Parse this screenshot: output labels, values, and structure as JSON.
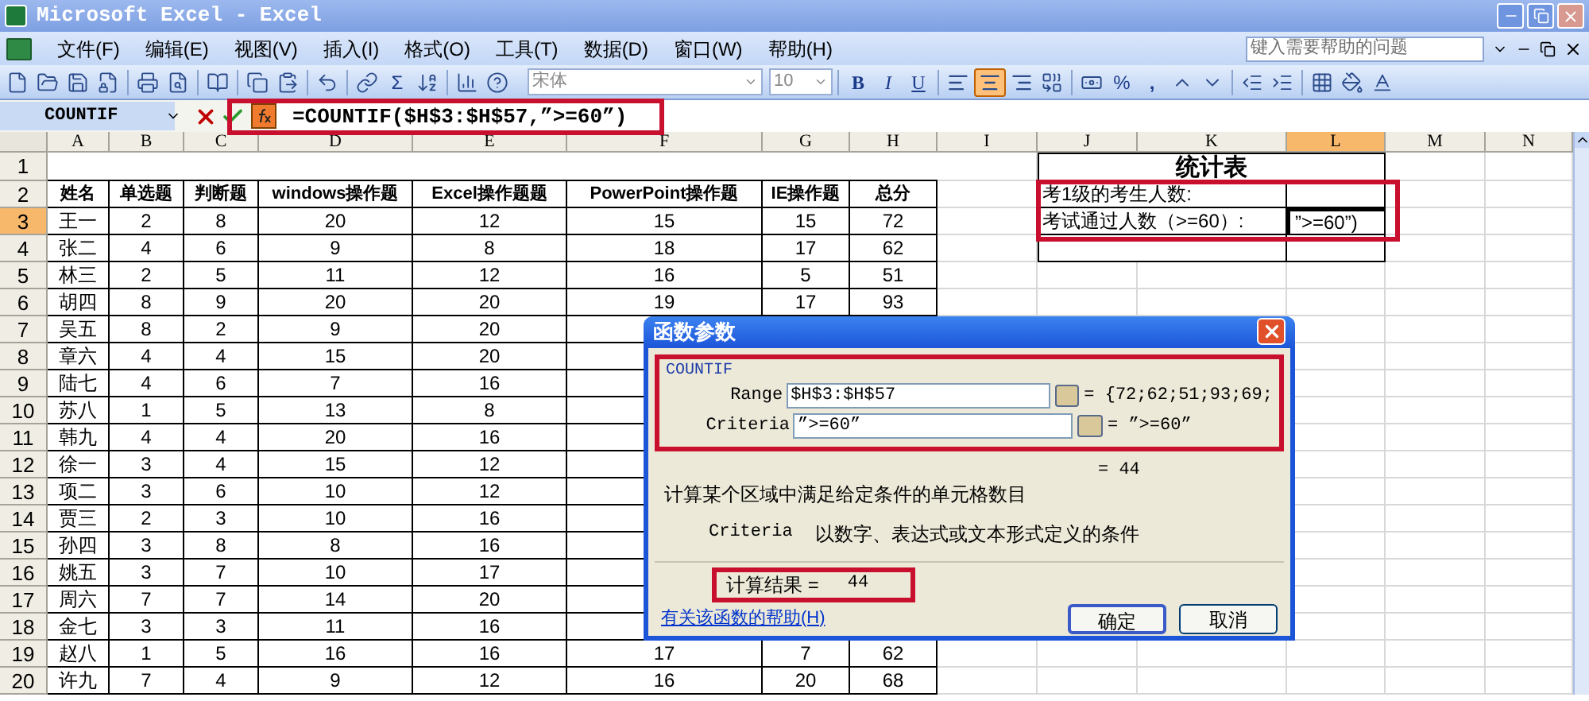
{
  "window": {
    "title": "Microsoft Excel - Excel"
  },
  "menu": [
    {
      "label": "文件(F)"
    },
    {
      "label": "编辑(E)"
    },
    {
      "label": "视图(V)"
    },
    {
      "label": "插入(I)"
    },
    {
      "label": "格式(O)"
    },
    {
      "label": "工具(T)"
    },
    {
      "label": "数据(D)"
    },
    {
      "label": "窗口(W)"
    },
    {
      "label": "帮助(H)"
    }
  ],
  "help_search": {
    "placeholder": "键入需要帮助的问题"
  },
  "toolbar": {
    "autosum": "Σ",
    "font": "宋体",
    "font_size": "10",
    "bold": "B",
    "italic": "I",
    "underline": "U",
    "percent": "%",
    "comma": ",",
    "alignment": [
      {
        "selected": false
      },
      {
        "selected": true
      },
      {
        "selected": false
      }
    ]
  },
  "formula_bar": {
    "name_box": "COUNTIF",
    "formula": "=COUNTIF($H$3:$H$57,”>=60”)"
  },
  "columns": [
    {
      "label": "A",
      "selected": false
    },
    {
      "label": "B",
      "selected": false
    },
    {
      "label": "C",
      "selected": false
    },
    {
      "label": "D",
      "selected": false
    },
    {
      "label": "E",
      "selected": false
    },
    {
      "label": "F",
      "selected": false
    },
    {
      "label": "G",
      "selected": false
    },
    {
      "label": "H",
      "selected": false
    },
    {
      "label": "I",
      "selected": false
    },
    {
      "label": "J",
      "selected": false
    },
    {
      "label": "K",
      "selected": false
    },
    {
      "label": "L",
      "selected": true
    },
    {
      "label": "M",
      "selected": false
    },
    {
      "label": "N",
      "selected": false
    }
  ],
  "sheet": {
    "rows": [
      {
        "num": "1",
        "selected": false,
        "kind": "blank",
        "cells": []
      },
      {
        "num": "2",
        "selected": false,
        "kind": "header",
        "cells": [
          "姓名",
          "单选题",
          "判断题",
          "windows操作题",
          "Excel操作题题",
          "PowerPoint操作题",
          "IE操作题",
          "总分"
        ]
      },
      {
        "num": "3",
        "selected": true,
        "kind": "data",
        "cells": [
          "王一",
          "2",
          "8",
          "20",
          "12",
          "15",
          "15",
          "72"
        ]
      },
      {
        "num": "4",
        "selected": false,
        "kind": "data",
        "cells": [
          "张二",
          "4",
          "6",
          "9",
          "8",
          "18",
          "17",
          "62"
        ]
      },
      {
        "num": "5",
        "selected": false,
        "kind": "data",
        "cells": [
          "林三",
          "2",
          "5",
          "11",
          "12",
          "16",
          "5",
          "51"
        ]
      },
      {
        "num": "6",
        "selected": false,
        "kind": "data",
        "cells": [
          "胡四",
          "8",
          "9",
          "20",
          "20",
          "19",
          "17",
          "93"
        ]
      },
      {
        "num": "7",
        "selected": false,
        "kind": "data",
        "cells": [
          "吴五",
          "8",
          "2",
          "9",
          "20"
        ]
      },
      {
        "num": "8",
        "selected": false,
        "kind": "data",
        "cells": [
          "章六",
          "4",
          "4",
          "15",
          "20"
        ]
      },
      {
        "num": "9",
        "selected": false,
        "kind": "data",
        "cells": [
          "陆七",
          "4",
          "6",
          "7",
          "16"
        ]
      },
      {
        "num": "10",
        "selected": false,
        "kind": "data",
        "cells": [
          "苏八",
          "1",
          "5",
          "13",
          "8"
        ]
      },
      {
        "num": "11",
        "selected": false,
        "kind": "data",
        "cells": [
          "韩九",
          "4",
          "4",
          "20",
          "16"
        ]
      },
      {
        "num": "12",
        "selected": false,
        "kind": "data",
        "cells": [
          "徐一",
          "3",
          "4",
          "15",
          "12"
        ]
      },
      {
        "num": "13",
        "selected": false,
        "kind": "data",
        "cells": [
          "项二",
          "3",
          "6",
          "10",
          "12"
        ]
      },
      {
        "num": "14",
        "selected": false,
        "kind": "data",
        "cells": [
          "贾三",
          "2",
          "3",
          "10",
          "16"
        ]
      },
      {
        "num": "15",
        "selected": false,
        "kind": "data",
        "cells": [
          "孙四",
          "3",
          "8",
          "8",
          "16"
        ]
      },
      {
        "num": "16",
        "selected": false,
        "kind": "data",
        "cells": [
          "姚五",
          "3",
          "7",
          "10",
          "17"
        ]
      },
      {
        "num": "17",
        "selected": false,
        "kind": "data",
        "cells": [
          "周六",
          "7",
          "7",
          "14",
          "20"
        ]
      },
      {
        "num": "18",
        "selected": false,
        "kind": "data",
        "cells": [
          "金七",
          "3",
          "3",
          "11",
          "16"
        ]
      },
      {
        "num": "19",
        "selected": false,
        "kind": "data",
        "cells": [
          "赵八",
          "1",
          "5",
          "16",
          "16",
          "17",
          "7",
          "62"
        ]
      },
      {
        "num": "20",
        "selected": false,
        "kind": "data",
        "cells": [
          "许九",
          "7",
          "4",
          "9",
          "12",
          "16",
          "20",
          "68"
        ]
      }
    ]
  },
  "stats": {
    "title": "统计表",
    "rows": [
      {
        "label": "考1级的考生人数:"
      },
      {
        "label": "考试通过人数（>=60）:",
        "value": "”>=60”)"
      }
    ]
  },
  "dialog": {
    "title": "函数参数",
    "function": "COUNTIF",
    "args": [
      {
        "label": "Range",
        "value": "$H$3:$H$57",
        "result": "= {72;62;51;93;69;"
      },
      {
        "label": "Criteria",
        "value": "”>=60”",
        "result": "= ”>=60”"
      }
    ],
    "total": "= 44",
    "description": "计算某个区域中满足给定条件的单元格数目",
    "arg_help": {
      "name": "Criteria",
      "text": "以数字、表达式或文本形式定义的条件"
    },
    "result_label": "计算结果 =",
    "result_value": "44",
    "help_link": "有关该函数的帮助(H)",
    "buttons": [
      {
        "label": "确定",
        "default": true
      },
      {
        "label": "取消",
        "default": false
      }
    ]
  }
}
